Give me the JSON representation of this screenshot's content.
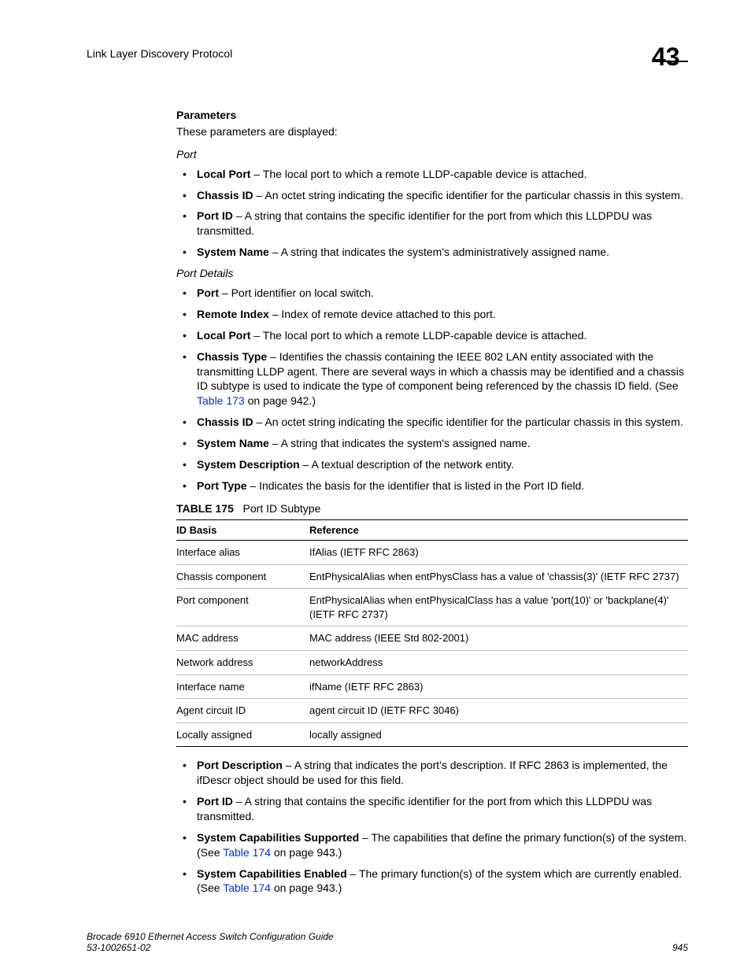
{
  "header": {
    "section_name": "Link Layer Discovery Protocol",
    "chapter_number": "43"
  },
  "sections": {
    "parameters_heading": "Parameters",
    "parameters_intro": "These parameters are displayed:",
    "port_subhead": "Port",
    "port_items": [
      {
        "term": "Local Port",
        "desc": " – The local port to which a remote LLDP-capable device is attached."
      },
      {
        "term": "Chassis ID",
        "desc": " – An octet string indicating the specific identifier for the particular chassis in this system."
      },
      {
        "term": "Port ID",
        "desc": " – A string that contains the specific identifier for the port from which this LLDPDU was transmitted."
      },
      {
        "term": "System Name",
        "desc": " – A string that indicates the system's administratively assigned name."
      }
    ],
    "port_details_subhead": "Port Details",
    "port_details_pre": [
      {
        "term": "Port",
        "desc": " – Port identifier on local switch."
      },
      {
        "term": "Remote Index",
        "desc": " – Index of remote device attached to this port."
      },
      {
        "term": "Local Port",
        "desc": " – The local port to which a remote LLDP-capable device is attached."
      }
    ],
    "chassis_type": {
      "term": "Chassis Type",
      "desc_before": " – Identifies the chassis containing the IEEE 802 LAN entity associated with the transmitting LLDP agent. There are several ways in which a chassis may be identified and a chassis ID subtype is used to indicate the type of component being referenced by the chassis ID field. (See ",
      "link": "Table 173",
      "desc_after": " on page 942.)"
    },
    "port_details_mid": [
      {
        "term": "Chassis ID",
        "desc": " – An octet string indicating the specific identifier for the particular chassis in this system."
      },
      {
        "term": "System Name",
        "desc": " – A string that indicates the system's assigned name."
      },
      {
        "term": "System Description",
        "desc": " – A textual description of the network entity."
      },
      {
        "term": "Port Type",
        "desc": " – Indicates the basis for the identifier that is listed in the Port ID field."
      }
    ],
    "table175": {
      "label": "TABLE 175",
      "title": "Port ID Subtype",
      "head_id": "ID Basis",
      "head_ref": "Reference",
      "rows": [
        {
          "id": "Interface alias",
          "ref": "IfAlias (IETF RFC 2863)"
        },
        {
          "id": "Chassis component",
          "ref": "EntPhysicalAlias when entPhysClass has a value of 'chassis(3)' (IETF RFC 2737)"
        },
        {
          "id": "Port component",
          "ref": "EntPhysicalAlias when entPhysicalClass has a value 'port(10)' or 'backplane(4)' (IETF RFC 2737)"
        },
        {
          "id": "MAC address",
          "ref": "MAC address (IEEE Std 802-2001)"
        },
        {
          "id": "Network address",
          "ref": "networkAddress"
        },
        {
          "id": "Interface name",
          "ref": "ifName (IETF RFC 2863)"
        },
        {
          "id": "Agent circuit ID",
          "ref": "agent circuit ID (IETF RFC 3046)"
        },
        {
          "id": "Locally assigned",
          "ref": "locally assigned"
        }
      ]
    },
    "port_details_post": [
      {
        "term": "Port Description",
        "desc": " – A string that indicates the port's description. If RFC 2863 is implemented, the ifDescr object should be used for this field."
      },
      {
        "term": "Port ID",
        "desc": " – A string that contains the specific identifier for the port from which this LLDPDU was transmitted."
      }
    ],
    "syscap_supported": {
      "term": "System Capabilities Supported",
      "desc_before": " – The capabilities that define the primary function(s) of the system. (See ",
      "link": "Table 174",
      "desc_after": " on page 943.)"
    },
    "syscap_enabled": {
      "term": "System Capabilities Enabled",
      "desc_before": " – The primary function(s) of the system which are currently enabled. (See ",
      "link": "Table 174",
      "desc_after": " on page 943.)"
    }
  },
  "footer": {
    "doc_title": "Brocade 6910 Ethernet Access Switch Configuration Guide",
    "doc_code": "53-1002651-02",
    "page_no": "945"
  }
}
